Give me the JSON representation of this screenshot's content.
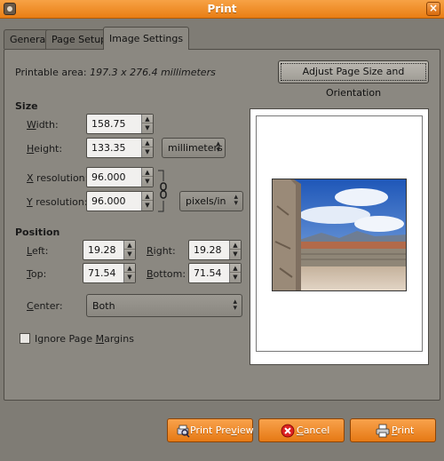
{
  "window": {
    "title": "Print"
  },
  "tabs": [
    {
      "label": "General"
    },
    {
      "label": "Page Setup"
    },
    {
      "label": "Image Settings",
      "active": true
    }
  ],
  "printable_area": {
    "label": "Printable area:",
    "value": "197.3 x 276.4 millimeters"
  },
  "adjust_button": {
    "label": "Adjust Page Size and Orientation"
  },
  "size": {
    "heading": "Size",
    "width": {
      "label_prefix": "W",
      "label_rest": "idth:",
      "value": "158.75"
    },
    "height": {
      "label_prefix": "H",
      "label_rest": "eight:",
      "value": "133.35"
    },
    "unit": "millimeters",
    "x_resolution": {
      "label_prefix": "X",
      "label_rest": " resolution:",
      "value": "96.000"
    },
    "y_resolution": {
      "label_prefix": "Y",
      "label_rest": " resolution:",
      "value": "96.000"
    },
    "resolution_unit": "pixels/in"
  },
  "position": {
    "heading": "Position",
    "left": {
      "label_prefix": "L",
      "label_rest": "eft:",
      "value": "19.28"
    },
    "right": {
      "label_prefix": "R",
      "label_rest": "ight:",
      "value": "19.28"
    },
    "top": {
      "label_prefix": "T",
      "label_rest": "op:",
      "value": "71.54"
    },
    "bottom": {
      "label_prefix": "B",
      "label_rest": "ottom:",
      "value": "71.54"
    }
  },
  "center": {
    "label_prefix": "C",
    "label_rest": "enter:",
    "value": "Both"
  },
  "ignore_margins": {
    "label_pre": "Ignore Page ",
    "label_key": "M",
    "label_rest": "argins",
    "checked": false
  },
  "buttons": {
    "print_preview": {
      "pre": "Print Pre",
      "key": "v",
      "post": "iew",
      "icon": "print-preview-icon"
    },
    "cancel": {
      "pre": "",
      "key": "C",
      "post": "ancel",
      "icon": "cancel-icon"
    },
    "print": {
      "pre": "",
      "key": "P",
      "post": "rint",
      "icon": "printer-icon"
    }
  },
  "colors": {
    "accent": "#e97e14",
    "background": "#8b8881"
  }
}
